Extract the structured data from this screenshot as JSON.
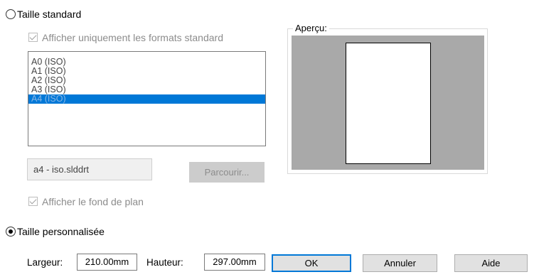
{
  "standard_size": {
    "label": "Taille standard",
    "selected": false
  },
  "only_standard_formats": {
    "label": "Afficher uniquement les formats standard",
    "checked": true,
    "enabled": false
  },
  "formats": [
    {
      "label": "A0 (ISO)",
      "selected": false
    },
    {
      "label": "A1 (ISO)",
      "selected": false
    },
    {
      "label": "A2 (ISO)",
      "selected": false
    },
    {
      "label": "A3 (ISO)",
      "selected": false
    },
    {
      "label": "A4 (ISO)",
      "selected": true
    }
  ],
  "template_file": {
    "value": "a4 - iso.slddrt"
  },
  "browse_button": {
    "label": "Parcourir..."
  },
  "show_background": {
    "label": "Afficher le fond de plan",
    "checked": true,
    "enabled": false
  },
  "preview": {
    "label": "Aperçu:"
  },
  "custom_size": {
    "label": "Taille personnalisée",
    "selected": true
  },
  "width": {
    "label": "Largeur:",
    "value": "210.00mm"
  },
  "height": {
    "label": "Hauteur:",
    "value": "297.00mm"
  },
  "buttons": {
    "ok": "OK",
    "cancel": "Annuler",
    "help": "Aide"
  },
  "colors": {
    "accent": "#0078d7",
    "preview_bg": "#a9a9a9"
  }
}
